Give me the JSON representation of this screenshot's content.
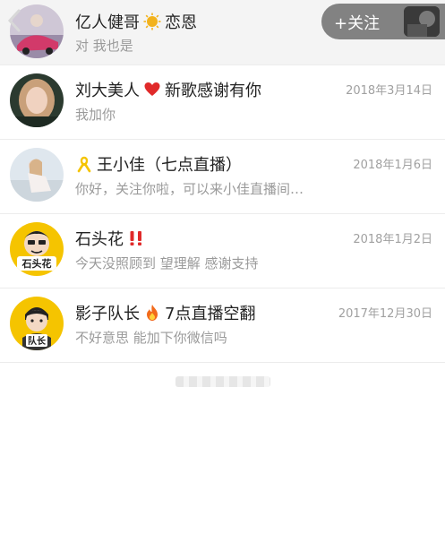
{
  "header": {
    "follow_label": "+关注",
    "back_icon": "chevron-left-icon"
  },
  "conversations": [
    {
      "name": "亿人健哥",
      "suffix": "恋恩",
      "date": "",
      "message": "对 我也是",
      "badge": "sun-emoji-icon"
    },
    {
      "name": "刘大美人",
      "suffix": "新歌感谢有你",
      "date": "2018年3月14日",
      "message": "我加你",
      "badge": "red-heart-icon"
    },
    {
      "name": "王小佳（七点直播）",
      "suffix": "",
      "date": "2018年1月6日",
      "message": "你好，关注你啦，可以来小佳直播间…",
      "badge": "yellow-ribbon-icon"
    },
    {
      "name": "石头花",
      "suffix": "",
      "date": "2018年1月2日",
      "message": "今天没照顾到 望理解 感谢支持",
      "badge": "double-exclamation-icon",
      "avatar_text": "石头花"
    },
    {
      "name": "影子队长",
      "suffix": "7点直播空翻",
      "date": "2017年12月30日",
      "message": "不好意思 能加下你微信吗",
      "badge": "fire-icon",
      "avatar_text": "队长"
    }
  ],
  "colors": {
    "accent_red": "#e02a2a",
    "text_gray": "#9a9a9a",
    "yellow": "#f5c400"
  }
}
